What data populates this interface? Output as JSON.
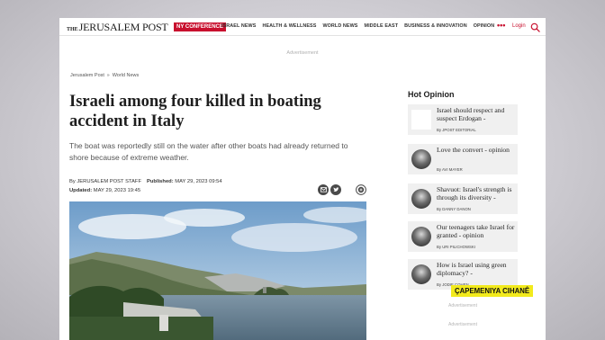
{
  "nav": {
    "logo_the": "THE",
    "logo_name": "JERUSALEM POST",
    "ny_button": "NY CONFERENCE",
    "links": [
      "ISRAEL NEWS",
      "HEALTH & WELLNESS",
      "WORLD NEWS",
      "MIDDLE EAST",
      "BUSINESS & INNOVATION",
      "OPINION"
    ],
    "more": "•••",
    "login": "Login"
  },
  "ads": {
    "top": "Advertisement",
    "side1": "Advertisement",
    "side2": "Advertisement"
  },
  "breadcrumb": {
    "home": "Jerusalem Post",
    "separator": "»",
    "section": "World News"
  },
  "article": {
    "headline": "Israeli among four killed in boating accident in Italy",
    "summary": "The boat was reportedly still on the water after other boats had already returned to shore because of extreme weather.",
    "byline_prefix": "By",
    "author": "JERUSALEM POST STAFF",
    "published_label": "Published:",
    "published": "MAY 29, 2023 09:54",
    "updated_label": "Updated:",
    "updated": "MAY 29, 2023 19:45"
  },
  "sidebar": {
    "title": "Hot Opinion",
    "items": [
      {
        "title": "Israel should respect and suspect Erdogan -",
        "author": "By JPOST EDITORIAL"
      },
      {
        "title": "Love the convert - opinion",
        "author": "By AVI MAYER"
      },
      {
        "title": "Shavuot: Israel's strength is through its diversity -",
        "author": "By DANNY DANON"
      },
      {
        "title": "Our teenagers take Israel for granted - opinion",
        "author": "By URI PILICHOWSKI"
      },
      {
        "title": "How is Israel using green diplomacy? -",
        "author": "By JODIE COHEN"
      }
    ]
  },
  "overlay": {
    "tag": "ÇAPEMENIYA CIHANÊ"
  },
  "colors": {
    "brand_red": "#c8102e",
    "tag_yellow": "#f2ea1c"
  },
  "icons": [
    "search-icon",
    "email-icon",
    "twitter-icon",
    "plus-icon"
  ]
}
